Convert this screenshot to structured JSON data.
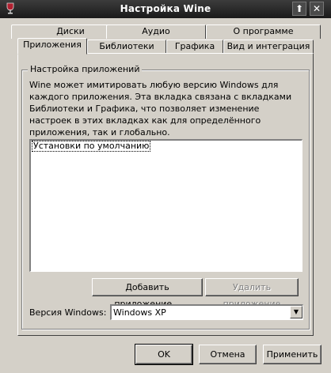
{
  "window": {
    "title": "Настройка Wine",
    "up_glyph": "⬆",
    "close_glyph": "✕"
  },
  "tabs": {
    "back_row": [
      {
        "label": "Диски"
      },
      {
        "label": "Аудио"
      },
      {
        "label": "О программе"
      }
    ],
    "front_row": [
      {
        "label": "Приложения",
        "active": true
      },
      {
        "label": "Библиотеки"
      },
      {
        "label": "Графика"
      },
      {
        "label": "Вид и интеграция"
      }
    ]
  },
  "group": {
    "title": "Настройка приложений",
    "description": "Wine может имитировать любую версию Windows для каждого приложения. Эта вкладка связана с вкладками Библиотеки и Графика, что позволяет изменение настроек в этих вкладках как для определённого приложения, так и глобально."
  },
  "applications": {
    "items": [
      "Установки по умолчанию"
    ],
    "selected_index": 0
  },
  "buttons": {
    "add_app": "Добавить приложение...",
    "remove_app": "Удалить приложение",
    "ok": "OK",
    "cancel": "Отмена",
    "apply": "Применить"
  },
  "windows_version": {
    "label": "Версия Windows:",
    "value": "Windows XP"
  }
}
